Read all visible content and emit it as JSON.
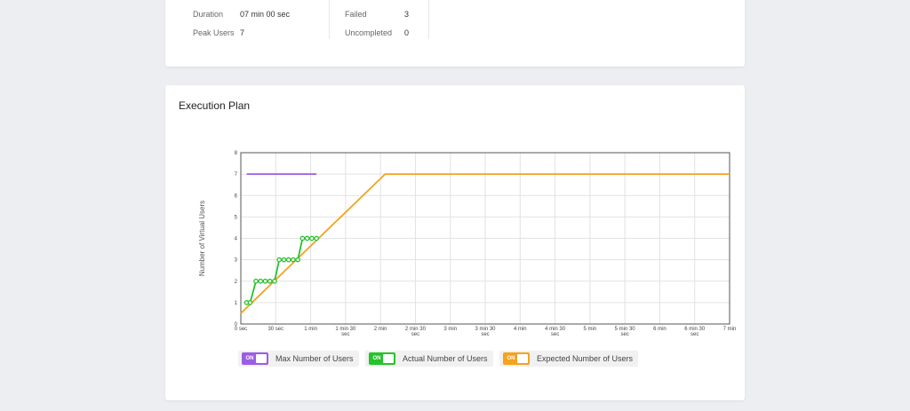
{
  "summary": {
    "duration_label": "Duration",
    "duration_value": "07 min 00 sec",
    "peak_users_label": "Peak Users",
    "peak_users_value": "7",
    "failed_label": "Failed",
    "failed_value": "3",
    "uncompleted_label": "Uncompleted",
    "uncompleted_value": "0"
  },
  "execution_plan": {
    "title": "Execution Plan"
  },
  "legend": [
    {
      "toggle_text": "ON",
      "label": "Max Number of Users",
      "color": "#9b5de5",
      "state": "on"
    },
    {
      "toggle_text": "ON",
      "label": "Actual Number of Users",
      "color": "#27c22c",
      "state": "on"
    },
    {
      "toggle_text": "ON",
      "label": "Expected Number of Users",
      "color": "#f6a21d",
      "state": "on"
    }
  ],
  "chart_data": {
    "type": "line",
    "title": "",
    "xlabel": "",
    "ylabel": "Number of Virtual Users",
    "xlim": [
      0,
      420
    ],
    "ylim": [
      0,
      8
    ],
    "grid": true,
    "legend_position": "bottom",
    "x_ticks": [
      {
        "value": 0,
        "label": [
          "0 sec"
        ]
      },
      {
        "value": 30,
        "label": [
          "30 sec"
        ]
      },
      {
        "value": 60,
        "label": [
          "1 min"
        ]
      },
      {
        "value": 90,
        "label": [
          "1 min 30",
          "sec"
        ]
      },
      {
        "value": 120,
        "label": [
          "2 min"
        ]
      },
      {
        "value": 150,
        "label": [
          "2 min 30",
          "sec"
        ]
      },
      {
        "value": 180,
        "label": [
          "3 min"
        ]
      },
      {
        "value": 210,
        "label": [
          "3 min 30",
          "sec"
        ]
      },
      {
        "value": 240,
        "label": [
          "4 min"
        ]
      },
      {
        "value": 270,
        "label": [
          "4 min 30",
          "sec"
        ]
      },
      {
        "value": 300,
        "label": [
          "5 min"
        ]
      },
      {
        "value": 330,
        "label": [
          "5 min 30",
          "sec"
        ]
      },
      {
        "value": 360,
        "label": [
          "6 min"
        ]
      },
      {
        "value": 390,
        "label": [
          "6 min 30",
          "sec"
        ]
      },
      {
        "value": 420,
        "label": [
          "7 min"
        ]
      }
    ],
    "y_ticks": [
      0,
      1,
      2,
      3,
      4,
      5,
      6,
      7,
      8
    ],
    "series": [
      {
        "name": "Max Number of Users",
        "color": "#9b5de5",
        "markers": false,
        "points": [
          [
            5,
            7
          ],
          [
            65,
            7
          ]
        ]
      },
      {
        "name": "Expected Number of Users",
        "color": "#f6a21d",
        "markers": false,
        "points": [
          [
            0,
            0.5
          ],
          [
            124,
            7
          ],
          [
            420,
            7
          ]
        ]
      },
      {
        "name": "Actual Number of Users",
        "color": "#27c22c",
        "markers": true,
        "points": [
          [
            5,
            1
          ],
          [
            8,
            1
          ],
          [
            13,
            2
          ],
          [
            17,
            2
          ],
          [
            21,
            2
          ],
          [
            25,
            2
          ],
          [
            29,
            2
          ],
          [
            33,
            3
          ],
          [
            37,
            3
          ],
          [
            41,
            3
          ],
          [
            45,
            3
          ],
          [
            49,
            3
          ],
          [
            53,
            4
          ],
          [
            57,
            4
          ],
          [
            61,
            4
          ],
          [
            65,
            4
          ]
        ]
      }
    ]
  }
}
